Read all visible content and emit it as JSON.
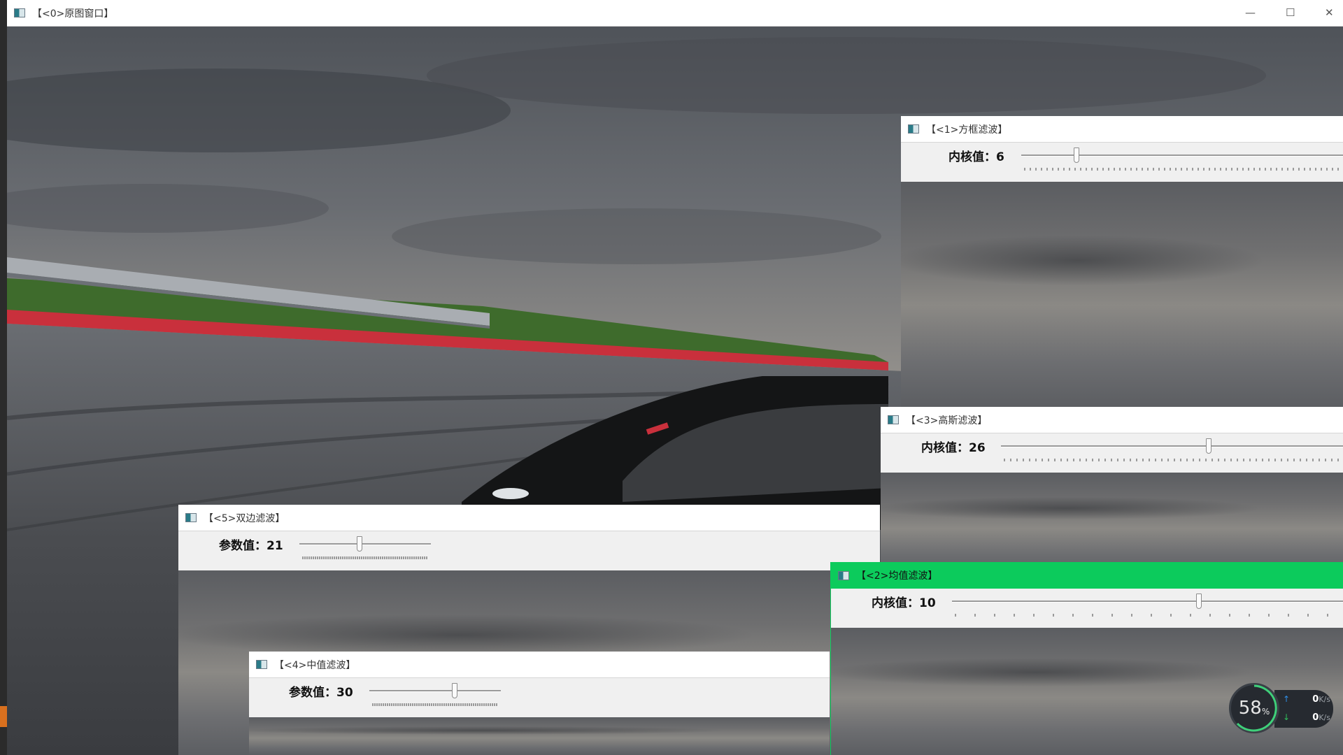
{
  "main_window": {
    "title": "【<0>原图窗口】",
    "controls": {
      "minimize": "—",
      "maximize": "☐",
      "close": "✕"
    }
  },
  "windows": [
    {
      "id": "box",
      "title": "【<1>方框滤波】",
      "label": "内核值：",
      "value": "6",
      "level": 0.12,
      "active": false
    },
    {
      "id": "gaussian",
      "title": "【<3>高斯滤波】",
      "label": "内核值：",
      "value": "26",
      "level": 0.5,
      "active": false
    },
    {
      "id": "bilateral",
      "title": "【<5>双边滤波】",
      "label": "参数值：",
      "value": "21",
      "level": 0.45,
      "active": false
    },
    {
      "id": "mean",
      "title": "【<2>均值滤波】",
      "label": "内核值：",
      "value": "10",
      "level": 0.5,
      "active": true
    },
    {
      "id": "median",
      "title": "【<4>中值滤波】",
      "label": "参数值：",
      "value": "30",
      "level": 0.6,
      "active": false
    }
  ],
  "net_widget": {
    "percent": "58",
    "percent_unit": "%",
    "upload": "0",
    "download": "0",
    "unit": "K/s",
    "up_arrow": "↑",
    "down_arrow": "↓"
  }
}
